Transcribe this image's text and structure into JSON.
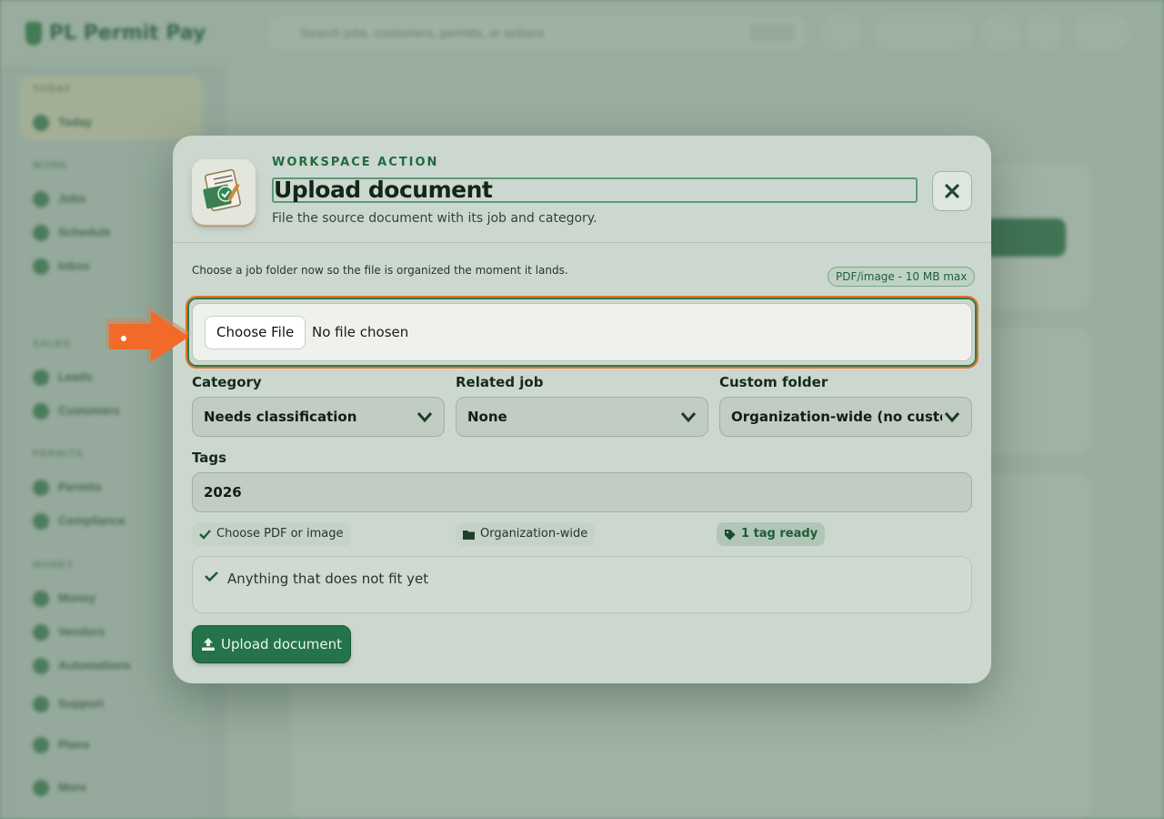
{
  "background": {
    "app_name": "PL Permit Pay",
    "search_placeholder": "Search jobs, customers, permits, or actions",
    "nav_sections": [
      "TODAY",
      "WORK",
      "SALES",
      "PERMITS",
      "MONEY"
    ],
    "nav_items": [
      "Today",
      "Jobs",
      "Schedule",
      "Inbox",
      "Leads",
      "Customers",
      "Permits",
      "Compliance",
      "Money",
      "Vendors",
      "Automations",
      "Support",
      "Plans",
      "More"
    ]
  },
  "modal": {
    "eyebrow": "WORKSPACE ACTION",
    "title": "Upload document",
    "subtitle": "File the source document with its job and category.",
    "hint": "Choose a job folder now so the file is organized the moment it lands.",
    "limit_badge": "PDF/image - 10 MB max",
    "file_input": {
      "button_label": "Choose File",
      "status": "No file chosen"
    },
    "category": {
      "label": "Category",
      "value": "Needs classification"
    },
    "related_job": {
      "label": "Related job",
      "value": "None"
    },
    "custom_folder": {
      "label": "Custom folder",
      "value": "Organization-wide (no custom folder)"
    },
    "tags": {
      "label": "Tags",
      "value": "2026"
    },
    "chips": {
      "file_type": "Choose PDF or image",
      "scope": "Organization-wide",
      "tags_ready": "1 tag ready"
    },
    "note": "Anything that does not fit yet",
    "submit_label": "Upload document"
  },
  "colors": {
    "accent_green": "#24734a",
    "highlight_orange": "#e9712e"
  }
}
